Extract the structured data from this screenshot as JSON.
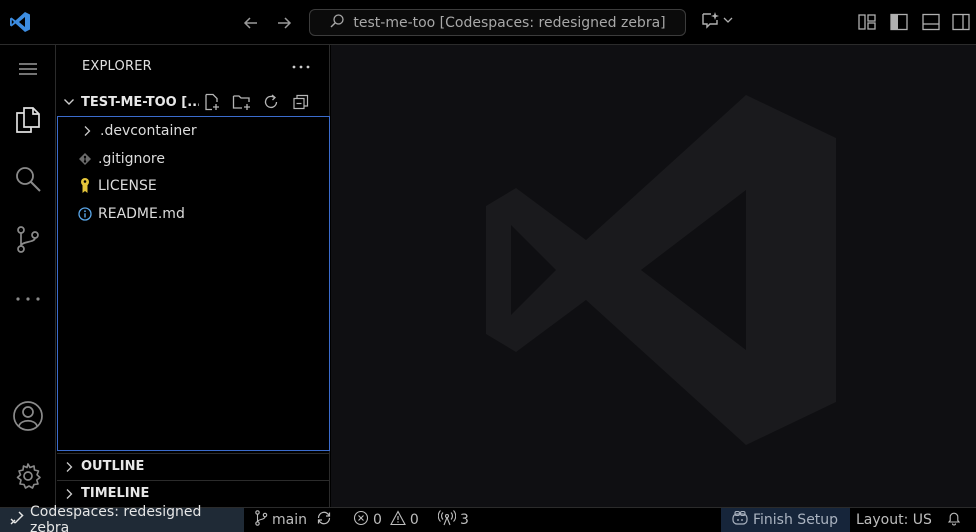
{
  "titlebar": {
    "search_text": "test-me-too [Codespaces: redesigned zebra]",
    "icons": [
      "vscode-logo-icon",
      "arrow-left-icon",
      "arrow-right-icon",
      "search-icon",
      "copilot-icon",
      "chevron-down-icon",
      "customize-layout-icon",
      "toggle-sidebar-icon",
      "toggle-panel-icon",
      "toggle-secondary-sidebar-icon"
    ]
  },
  "activitybar": {
    "icons": [
      "menu-icon",
      "files-icon",
      "search-icon",
      "source-control-icon",
      "more-icon",
      "account-icon",
      "settings-icon"
    ]
  },
  "sidebar": {
    "title": "EXPLORER",
    "folder_name": "TEST-ME-TOO [...",
    "items": [
      {
        "label": ".devcontainer",
        "icon": "chevron-right-icon"
      },
      {
        "label": ".gitignore",
        "icon": "git-diamond-icon"
      },
      {
        "label": "LICENSE",
        "icon": "license-key-icon"
      },
      {
        "label": "README.md",
        "icon": "info-icon"
      }
    ],
    "sections": [
      {
        "label": "OUTLINE"
      },
      {
        "label": "TIMELINE"
      }
    ]
  },
  "statusbar": {
    "remote": "Codespaces: redesigned zebra",
    "branch": "main",
    "errors": "0",
    "warnings": "0",
    "ports": "3",
    "finish_setup": "Finish Setup",
    "layout": "Layout: US"
  },
  "colors": {
    "accent_border": "#3b6ccd",
    "vscode_blue": "#3c8ce0",
    "license_yellow": "#e4c53a",
    "info_blue": "#5aa6e8"
  }
}
